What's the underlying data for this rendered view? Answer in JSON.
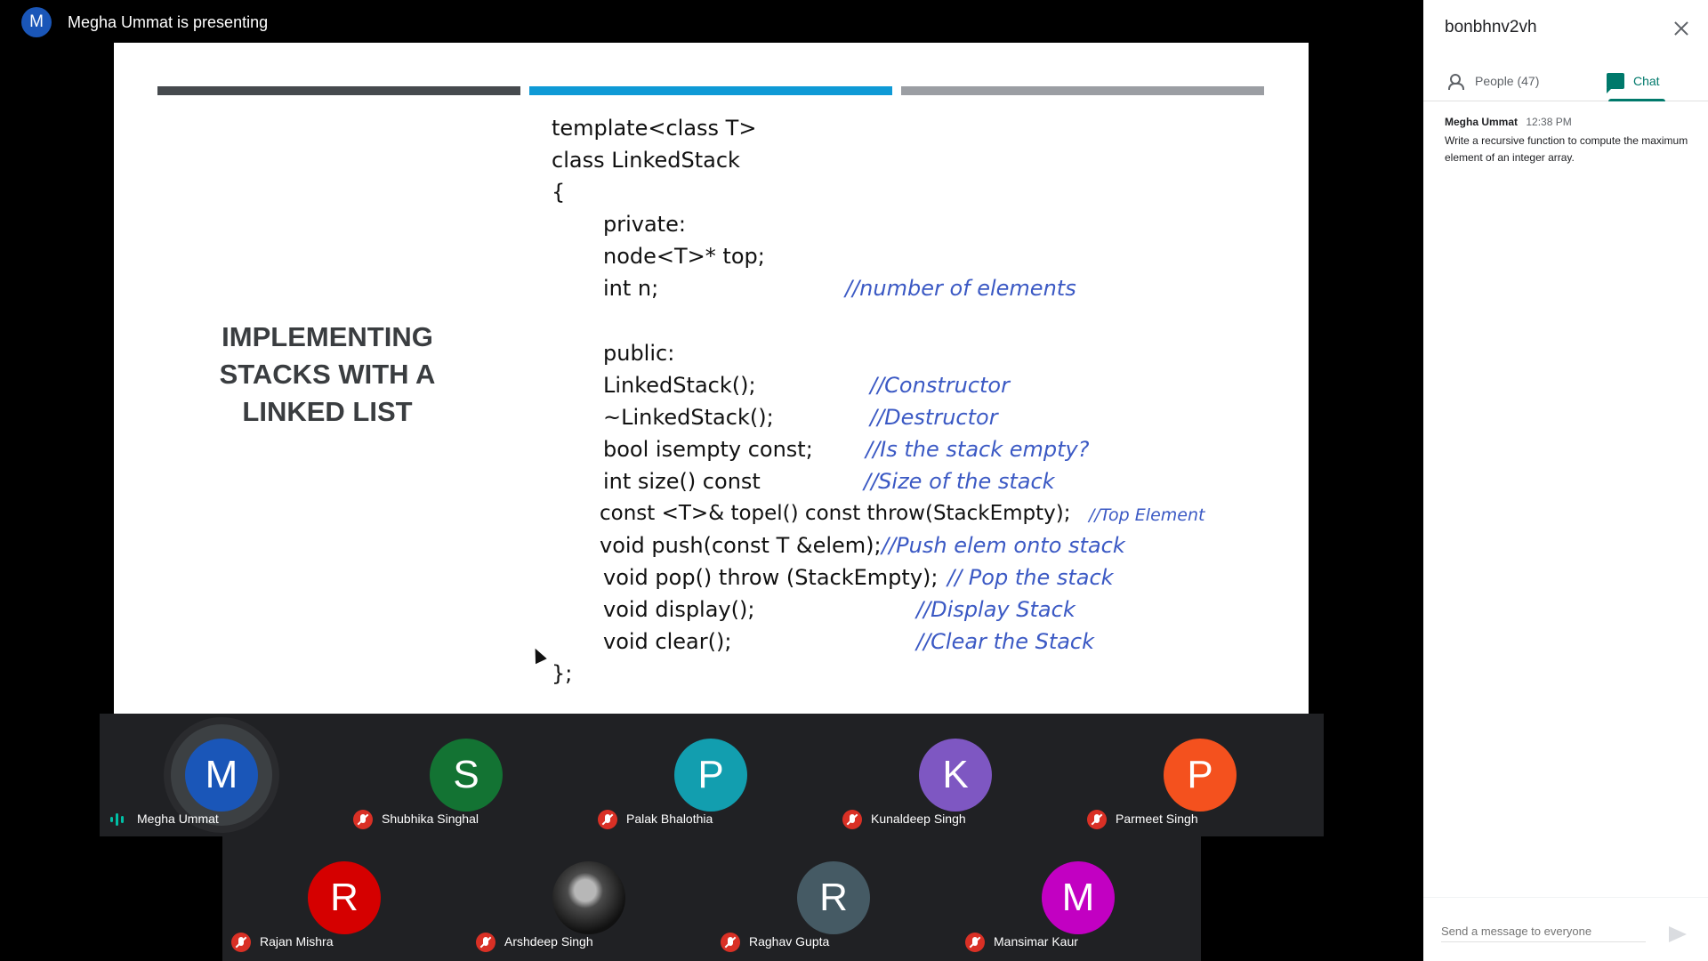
{
  "stage": {
    "presenter_initial": "M",
    "presenter_text": "Megha Ummat is presenting"
  },
  "slide": {
    "title_lines": [
      "IMPLEMENTING",
      "STACKS WITH A",
      "LINKED LIST"
    ],
    "code_lines": [
      "template<class T>",
      "class LinkedStack",
      "{",
      "private:",
      "node<T>* top;",
      "int n;",
      "public:",
      "LinkedStack();",
      "~LinkedStack();",
      "bool isempty const;",
      "int size() const",
      "const <T>& topel() const throw(StackEmpty);",
      "void push(const T &elem);",
      "void pop() throw (StackEmpty);",
      "void display();",
      "void clear();",
      "};"
    ],
    "comments": [
      "//number of elements",
      "//Constructor",
      "//Destructor",
      "//Is the stack empty?",
      "//Size of the stack",
      "//Top Element",
      "//Push elem onto stack",
      "// Pop the stack",
      "//Display Stack",
      "//Clear the Stack"
    ]
  },
  "participants": [
    {
      "initial": "M",
      "name": "Megha Ummat",
      "color": "#1a56b8",
      "muted": false,
      "speaking": true
    },
    {
      "initial": "S",
      "name": "Shubhika Singhal",
      "color": "#137333",
      "muted": true
    },
    {
      "initial": "P",
      "name": "Palak Bhalothia",
      "color": "#129eaf",
      "muted": true
    },
    {
      "initial": "K",
      "name": "Kunaldeep Singh",
      "color": "#7e57c2",
      "muted": true
    },
    {
      "initial": "P",
      "name": "Parmeet Singh",
      "color": "#f4511e",
      "muted": true
    },
    {
      "initial": "R",
      "name": "Rajan Mishra",
      "color": "#d50000",
      "muted": true
    },
    {
      "initial": "",
      "name": "Arshdeep Singh",
      "color": "#111111",
      "muted": true,
      "photo": true
    },
    {
      "initial": "R",
      "name": "Raghav Gupta",
      "color": "#455a64",
      "muted": true
    },
    {
      "initial": "M",
      "name": "Mansimar Kaur",
      "color": "#c200c2",
      "muted": true
    }
  ],
  "panel": {
    "title": "bonbhnv2vh",
    "tab_people": "People (47)",
    "tab_chat": "Chat",
    "message": {
      "sender": "Megha Ummat",
      "time": "12:38 PM",
      "text": "Write a recursive function to compute the maximum element of an integer array."
    },
    "composer_placeholder": "Send a message to everyone"
  }
}
